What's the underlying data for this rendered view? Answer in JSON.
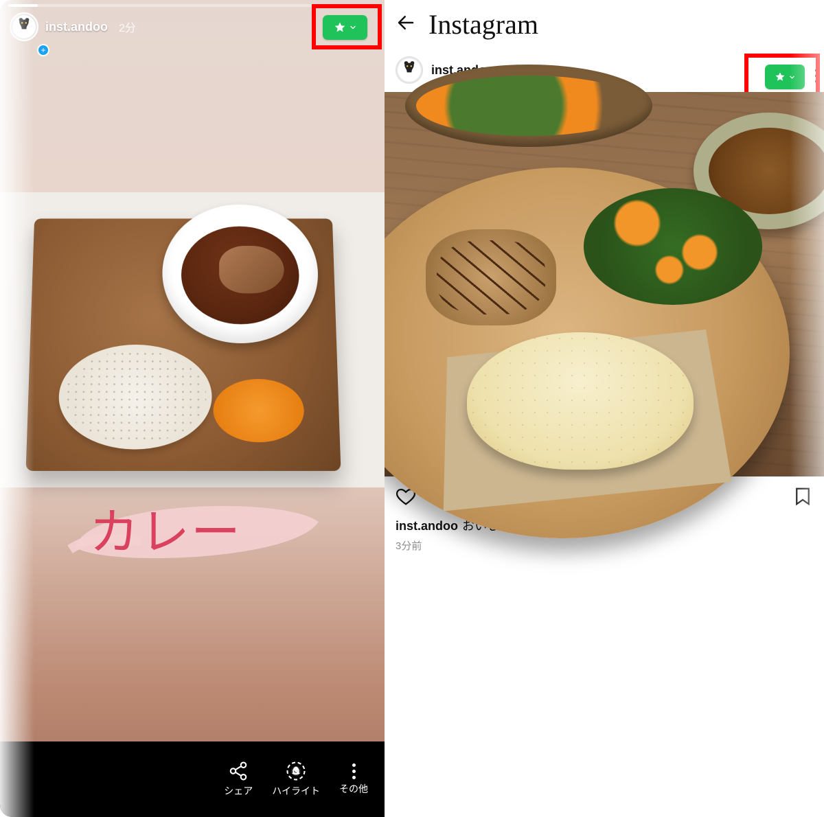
{
  "story": {
    "username": "inst.andoo",
    "time_label": "2分",
    "caption_text": "カレー",
    "bottom_actions": {
      "share": "シェア",
      "highlight": "ハイライト",
      "more": "その他"
    },
    "badge_icon": "star-icon"
  },
  "feed": {
    "app_title": "Instagram",
    "username": "inst.andoo",
    "caption_user": "inst.andoo",
    "caption_text": "おいしかったー！",
    "time_label": "3分前",
    "badge_icon": "star-icon"
  },
  "colors": {
    "badge_green": "#1fc35a",
    "highlight_red": "#ff0000",
    "caption_pink": "#d9415e"
  }
}
